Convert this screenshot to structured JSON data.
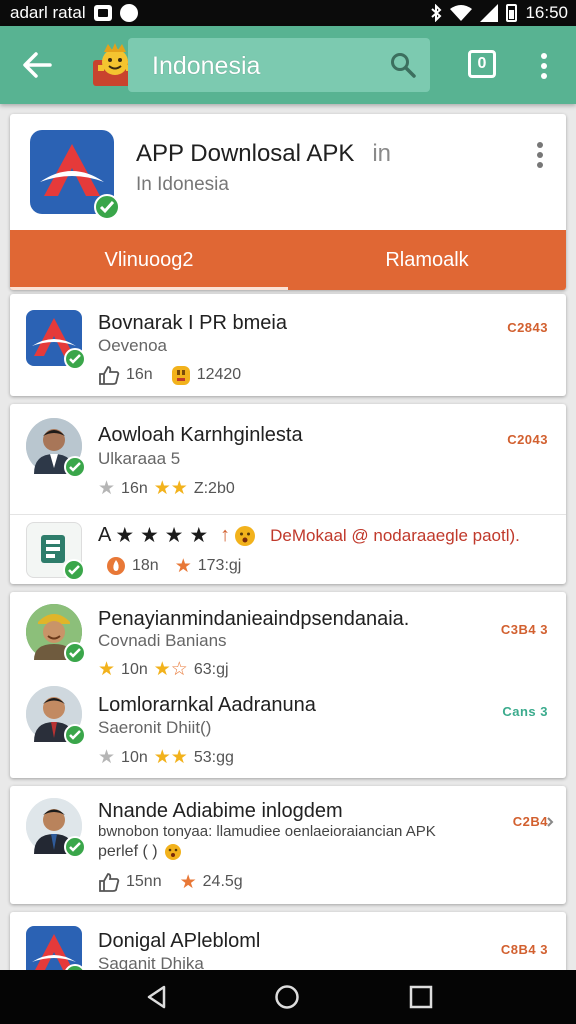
{
  "status_bar": {
    "carrier": "adarl ratal",
    "time": "16:50"
  },
  "app_bar": {
    "search_text": "Indonesia",
    "square_label": "0"
  },
  "hero": {
    "title": "APP Downlosal APK",
    "title_suffix": "in",
    "subtitle": "In Idonesia",
    "tabs": [
      {
        "label": "Vlinuoog2"
      },
      {
        "label": "Rlamoalk"
      }
    ]
  },
  "rows": [
    {
      "title": "Bovnarak I PR bmeia",
      "subtitle": "Oevenoa",
      "meta1": "16n",
      "meta2": "12420",
      "code": "C2843"
    },
    {
      "title": "Aowloah Karnhginlesta",
      "subtitle": "Ulkaraaa 5",
      "meta1": "16n",
      "meta2": "Z:2b0",
      "code": "C2043"
    },
    {
      "title": "A",
      "extra": "DeMokaal @ nodaraaegle paotl).",
      "meta1": "18n",
      "meta2": "173:gj"
    },
    {
      "title": "Penayianmindanieaindpsendanaia.",
      "subtitle": "Covnadi Banians",
      "meta1": "10n",
      "meta2": "63:gj",
      "code": "C3B4 3"
    },
    {
      "title": "Lomlorarnkal Aadranuna",
      "subtitle": "Saeronit Dhiit()",
      "meta1": "10n",
      "meta2": "53:gg",
      "code": "Cans 3"
    },
    {
      "title": "Nnande Adiabime inlogdem",
      "subtitle": "bwnobon tonyaa: llamudiee oenlaeioraiancian APK",
      "subtitle2": "perlef ( )",
      "meta1": "15nn",
      "meta2": "24.5g",
      "code": "C2B4"
    },
    {
      "title": "Donigal APlebloml",
      "subtitle": "Saganit Dhika",
      "code": "C8B4 3"
    }
  ],
  "colors": {
    "accent_green": "#58b392",
    "accent_orange": "#e06734",
    "badge_green": "#3aa64a"
  }
}
